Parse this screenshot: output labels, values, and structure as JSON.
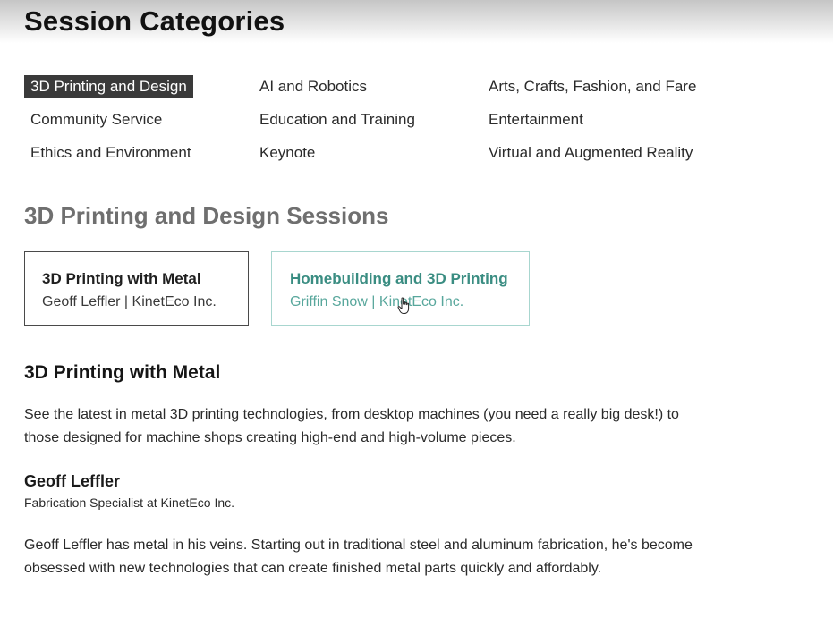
{
  "page": {
    "title": "Session Categories"
  },
  "categories": [
    {
      "label": "3D Printing and Design",
      "active": true
    },
    {
      "label": "AI and Robotics"
    },
    {
      "label": "Arts, Crafts, Fashion, and Fare"
    },
    {
      "label": "Community Service"
    },
    {
      "label": "Education and Training"
    },
    {
      "label": "Entertainment"
    },
    {
      "label": "Ethics and Environment"
    },
    {
      "label": "Keynote"
    },
    {
      "label": "Virtual and Augmented Reality"
    }
  ],
  "sessions": {
    "heading": "3D Printing and Design Sessions",
    "cards": [
      {
        "title": "3D Printing with Metal",
        "subtitle": "Geoff Leffler | KinetEco Inc."
      },
      {
        "title": "Homebuilding and 3D Printing",
        "subtitle": "Griffin Snow | KinetEco Inc."
      }
    ]
  },
  "detail": {
    "title": "3D Printing with Metal",
    "description": "See the latest in metal 3D printing technologies, from desktop machines (you need a really big desk!) to those designed for machine shops creating high-end and high-volume pieces.",
    "speaker": {
      "name": "Geoff Leffler",
      "role": "Fabrication Specialist at KinetEco Inc.",
      "bio": "Geoff Leffler has metal in his veins. Starting out in traditional steel and aluminum fabrication, he's become obsessed with new technologies that can create finished metal parts quickly and affordably."
    }
  },
  "colors": {
    "active_category_bg": "#3a3a3a",
    "hover_card_accent": "#3a8d82",
    "section_heading": "#6f6f6f"
  },
  "icons": {
    "cursor": "hand-pointer-icon"
  }
}
